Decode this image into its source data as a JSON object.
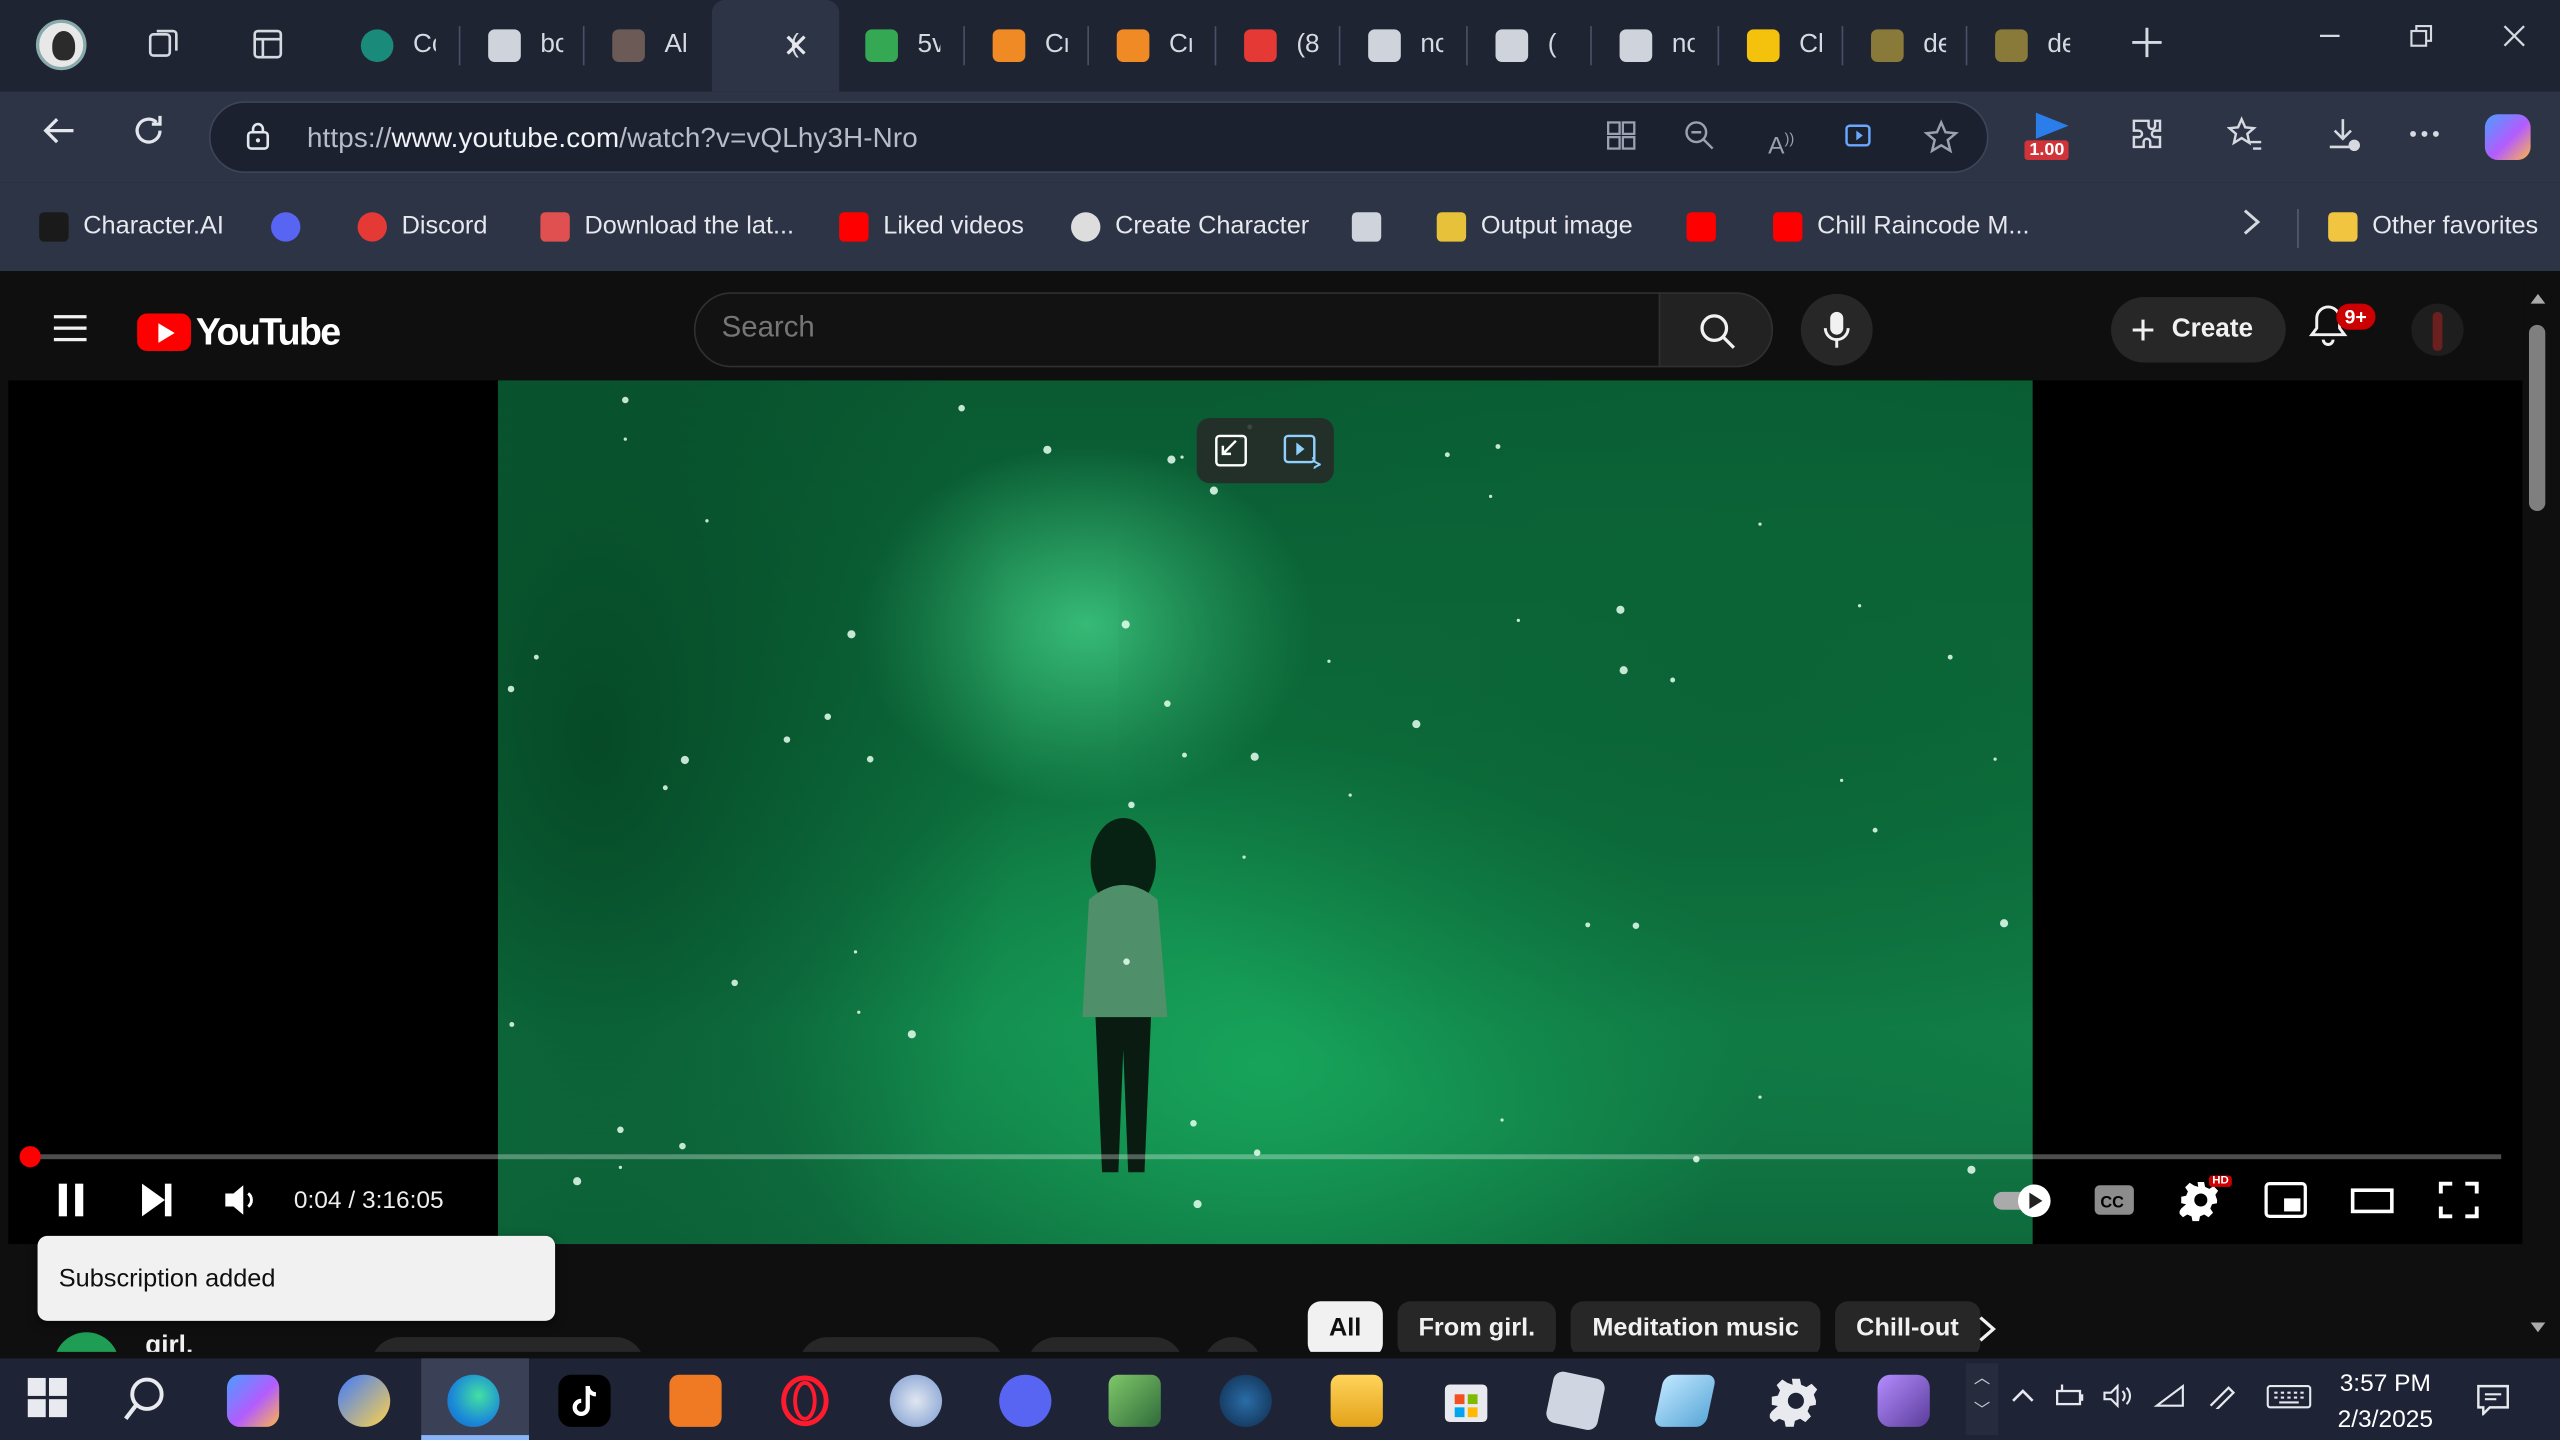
{
  "tabs": [
    {
      "label": "Cc",
      "color": "#1a8a7a"
    },
    {
      "label": "bc",
      "color": "#cfd3dc"
    },
    {
      "label": "Al",
      "color": "#6b5a55"
    },
    {
      "label": "(",
      "color": "#2d3446",
      "active": true
    },
    {
      "label": "5v",
      "color": "#34a853"
    },
    {
      "label": "Cr",
      "color": "#f08a24"
    },
    {
      "label": "Cr",
      "color": "#f08a24"
    },
    {
      "label": "(8",
      "color": "#e53935"
    },
    {
      "label": "nc",
      "color": "#cfd3dc"
    },
    {
      "label": "(",
      "color": "#cfd3dc"
    },
    {
      "label": "nc",
      "color": "#cfd3dc"
    },
    {
      "label": "Cl",
      "color": "#f4c20d"
    },
    {
      "label": "de",
      "color": "#8a7a3a"
    },
    {
      "label": "de",
      "color": "#8a7a3a"
    }
  ],
  "address_bar": {
    "url_prefix": "https://",
    "url_domain": "www.youtube.com",
    "url_path": "/watch?v=vQLhy3H-Nro",
    "extension_badge": "1.00"
  },
  "bookmarks": [
    {
      "label": "Character.AI",
      "color": "#1a1a1a"
    },
    {
      "label": "",
      "color": "#5865f2"
    },
    {
      "label": "Discord",
      "color": "#e53935"
    },
    {
      "label": "Download the lat...",
      "color": "#e05050"
    },
    {
      "label": "Liked videos",
      "color": "#ff0000"
    },
    {
      "label": "Create Character",
      "color": "#dddddd"
    },
    {
      "label": "",
      "color": "#cfd3dc"
    },
    {
      "label": "Output image",
      "color": "#e7c13a"
    },
    {
      "label": "",
      "color": "#ff0000"
    },
    {
      "label": "Chill Raincode M...",
      "color": "#ff0000"
    }
  ],
  "other_favorites": "Other favorites",
  "youtube": {
    "logo_text": "YouTube",
    "search_placeholder": "Search",
    "create_label": "Create",
    "notification_count": "9+",
    "player": {
      "time_display": "0:04 / 3:16:05",
      "progress": 0.0003,
      "hd_badge": "HD"
    },
    "toast": "Subscription added",
    "chips": [
      "All",
      "From girl.",
      "Meditation music",
      "Chill-out"
    ],
    "channel_name": "girl."
  },
  "taskbar": {
    "time": "3:57 PM",
    "date": "2/3/2025"
  }
}
